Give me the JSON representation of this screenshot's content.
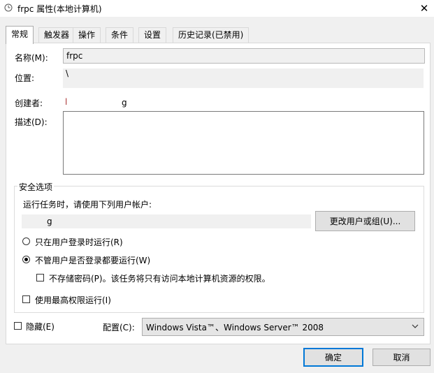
{
  "window": {
    "title": "frpc 属性(本地计算机)",
    "close_glyph": "✕"
  },
  "tabs": [
    "常规",
    "触发器",
    "操作",
    "条件",
    "设置",
    "历史记录(已禁用)"
  ],
  "general": {
    "name_label": "名称(M):",
    "name_value": "frpc",
    "location_label": "位置:",
    "location_value": "\\",
    "author_label": "创建者:",
    "author_value_a": "l",
    "author_value_b": "g",
    "description_label": "描述(D):"
  },
  "security": {
    "title": "安全选项",
    "run_as_prompt": "运行任务时，请使用下列用户帐户:",
    "user_account_value": "g",
    "change_user_button": "更改用户或组(U)...",
    "radio_logged_on": "只在用户登录时运行(R)",
    "radio_whether_logged_on": "不管用户是否登录都要运行(W)",
    "radio_selected": "whether_logged_on",
    "no_store_password": "不存储密码(P)。该任务将只有访问本地计算机资源的权限。",
    "highest_privileges": "使用最高权限运行(I)"
  },
  "bottom": {
    "hidden_label": "隐藏(E)",
    "configure_label": "配置(C):",
    "configure_value": "Windows Vista™、Windows Server™ 2008",
    "ok_button": "确定",
    "cancel_button": "取消"
  }
}
